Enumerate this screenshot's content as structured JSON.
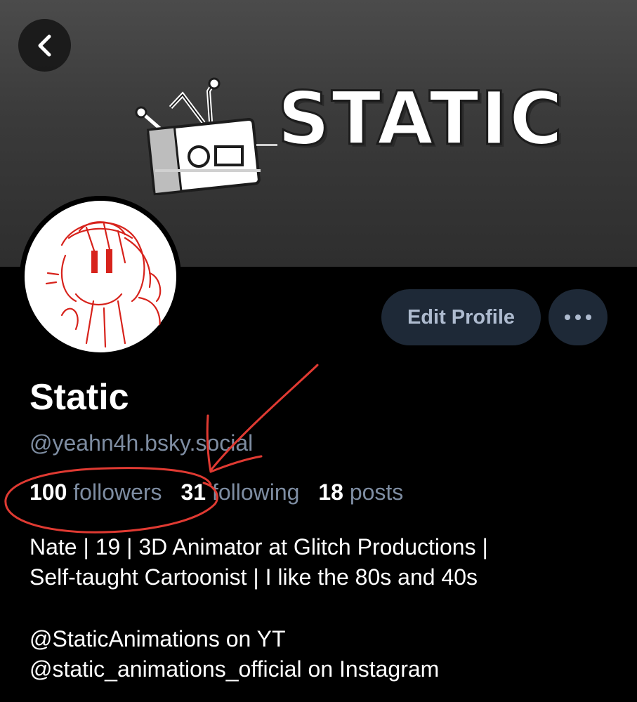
{
  "banner": {
    "logo_text": "STATIC",
    "back_icon": "chevron-left-icon"
  },
  "profile": {
    "display_name": "Static",
    "handle": "@yeahn4h.bsky.social",
    "edit_profile_label": "Edit Profile",
    "more_icon": "ellipsis-icon"
  },
  "stats": [
    {
      "count": "100",
      "label": "followers"
    },
    {
      "count": "31",
      "label": "following"
    },
    {
      "count": "18",
      "label": "posts"
    }
  ],
  "bio": {
    "line1": "Nate | 19 | 3D Animator at Glitch Productions |",
    "line2": "Self-taught Cartoonist | I like the 80s and 40s",
    "line3": "@StaticAnimations on YT",
    "line4": "@static_animations_official on Instagram"
  },
  "colors": {
    "background": "#000000",
    "muted_text": "#7e8da2",
    "button_bg": "#1e2937",
    "button_text": "#aebbcf",
    "annotation_red": "#e03a32"
  }
}
